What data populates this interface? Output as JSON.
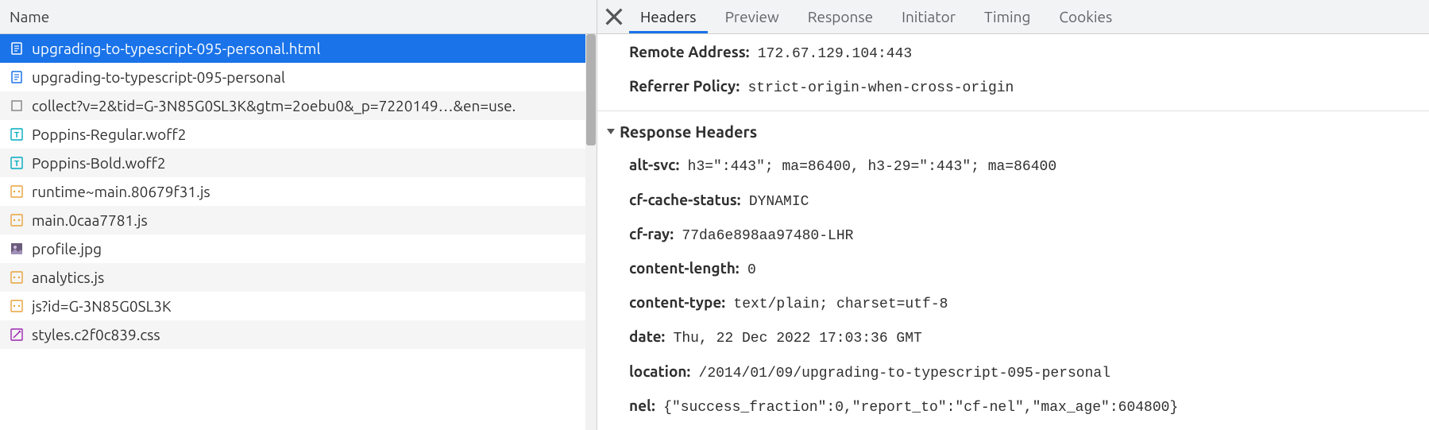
{
  "leftPanel": {
    "columnHeader": "Name",
    "requests": [
      {
        "icon": "doc",
        "label": "upgrading-to-typescript-095-personal.html",
        "selected": true
      },
      {
        "icon": "doc",
        "label": "upgrading-to-typescript-095-personal"
      },
      {
        "icon": "beacon",
        "label": "collect?v=2&tid=G-3N85G0SL3K&gtm=2oebu0&_p=7220149…&en=use."
      },
      {
        "icon": "font",
        "label": "Poppins-Regular.woff2"
      },
      {
        "icon": "font",
        "label": "Poppins-Bold.woff2"
      },
      {
        "icon": "js",
        "label": "runtime~main.80679f31.js"
      },
      {
        "icon": "js",
        "label": "main.0caa7781.js"
      },
      {
        "icon": "img",
        "label": "profile.jpg"
      },
      {
        "icon": "js",
        "label": "analytics.js"
      },
      {
        "icon": "js",
        "label": "js?id=G-3N85G0SL3K"
      },
      {
        "icon": "css",
        "label": "styles.c2f0c839.css"
      }
    ]
  },
  "rightPanel": {
    "tabs": [
      "Headers",
      "Preview",
      "Response",
      "Initiator",
      "Timing",
      "Cookies"
    ],
    "activeTab": "Headers",
    "general": [
      {
        "key": "Remote Address:",
        "value": "172.67.129.104:443"
      },
      {
        "key": "Referrer Policy:",
        "value": "strict-origin-when-cross-origin"
      }
    ],
    "responseHeadersTitle": "Response Headers",
    "responseHeaders": [
      {
        "key": "alt-svc:",
        "value": "h3=\":443\"; ma=86400, h3-29=\":443\"; ma=86400"
      },
      {
        "key": "cf-cache-status:",
        "value": "DYNAMIC"
      },
      {
        "key": "cf-ray:",
        "value": "77da6e898aa97480-LHR"
      },
      {
        "key": "content-length:",
        "value": "0"
      },
      {
        "key": "content-type:",
        "value": "text/plain; charset=utf-8"
      },
      {
        "key": "date:",
        "value": "Thu, 22 Dec 2022 17:03:36 GMT"
      },
      {
        "key": "location:",
        "value": "/2014/01/09/upgrading-to-typescript-095-personal"
      },
      {
        "key": "nel:",
        "value": "{\"success_fraction\":0,\"report_to\":\"cf-nel\",\"max_age\":604800}"
      }
    ]
  }
}
